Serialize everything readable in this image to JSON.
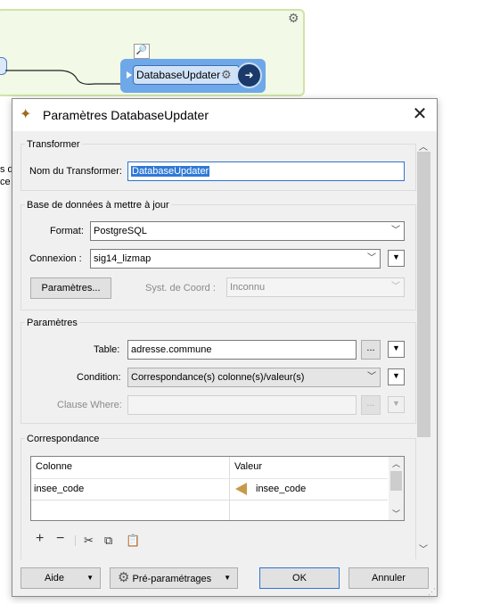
{
  "canvas": {
    "node_label": "DatabaseUpdater",
    "left_text_lines": [
      "s d",
      "ce c"
    ]
  },
  "dialog": {
    "title": "Paramètres DatabaseUpdater",
    "transformer": {
      "group_title": "Transformer",
      "name_label": "Nom du Transformer:",
      "name_value": "DatabaseUpdater"
    },
    "database": {
      "group_title": "Base de données à mettre à jour",
      "format_label": "Format:",
      "format_value": "PostgreSQL",
      "connection_label": "Connexion :",
      "connection_value": "sig14_lizmap",
      "params_button": "Paramètres...",
      "coord_label": "Syst. de Coord :",
      "coord_value": "Inconnu"
    },
    "parameters": {
      "group_title": "Paramètres",
      "table_label": "Table:",
      "table_value": "adresse.commune",
      "condition_label": "Condition:",
      "condition_value": "Correspondance(s) colonne(s)/valeur(s)",
      "where_label": "Clause Where:",
      "where_value": ""
    },
    "mapping": {
      "group_title": "Correspondance",
      "columns": [
        "Colonne",
        "Valeur"
      ],
      "rows": [
        {
          "column": "insee_code",
          "value": "insee_code"
        }
      ]
    },
    "footer": {
      "help": "Aide",
      "presets": "Pré-paramétrages",
      "ok": "OK",
      "cancel": "Annuler"
    }
  }
}
